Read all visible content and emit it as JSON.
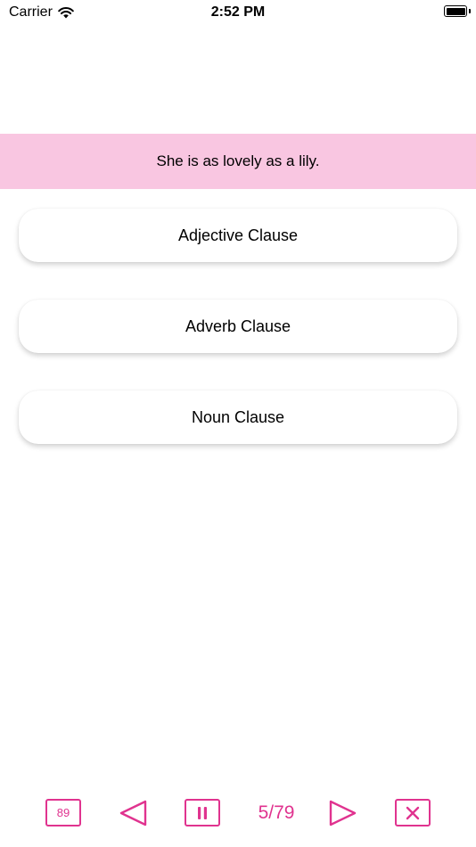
{
  "status_bar": {
    "carrier": "Carrier",
    "time": "2:52 PM"
  },
  "question": {
    "text": "She is as lovely as a lily."
  },
  "options": [
    {
      "label": "Adjective Clause"
    },
    {
      "label": "Adverb Clause"
    },
    {
      "label": "Noun Clause"
    }
  ],
  "toolbar": {
    "count_badge": "89",
    "page_indicator": "5/79",
    "icons": [
      "count-badge",
      "previous-icon",
      "pause-icon",
      "next-icon",
      "close-icon"
    ]
  },
  "colors": {
    "accent": "#e0338f",
    "banner": "#f9c6e1"
  }
}
